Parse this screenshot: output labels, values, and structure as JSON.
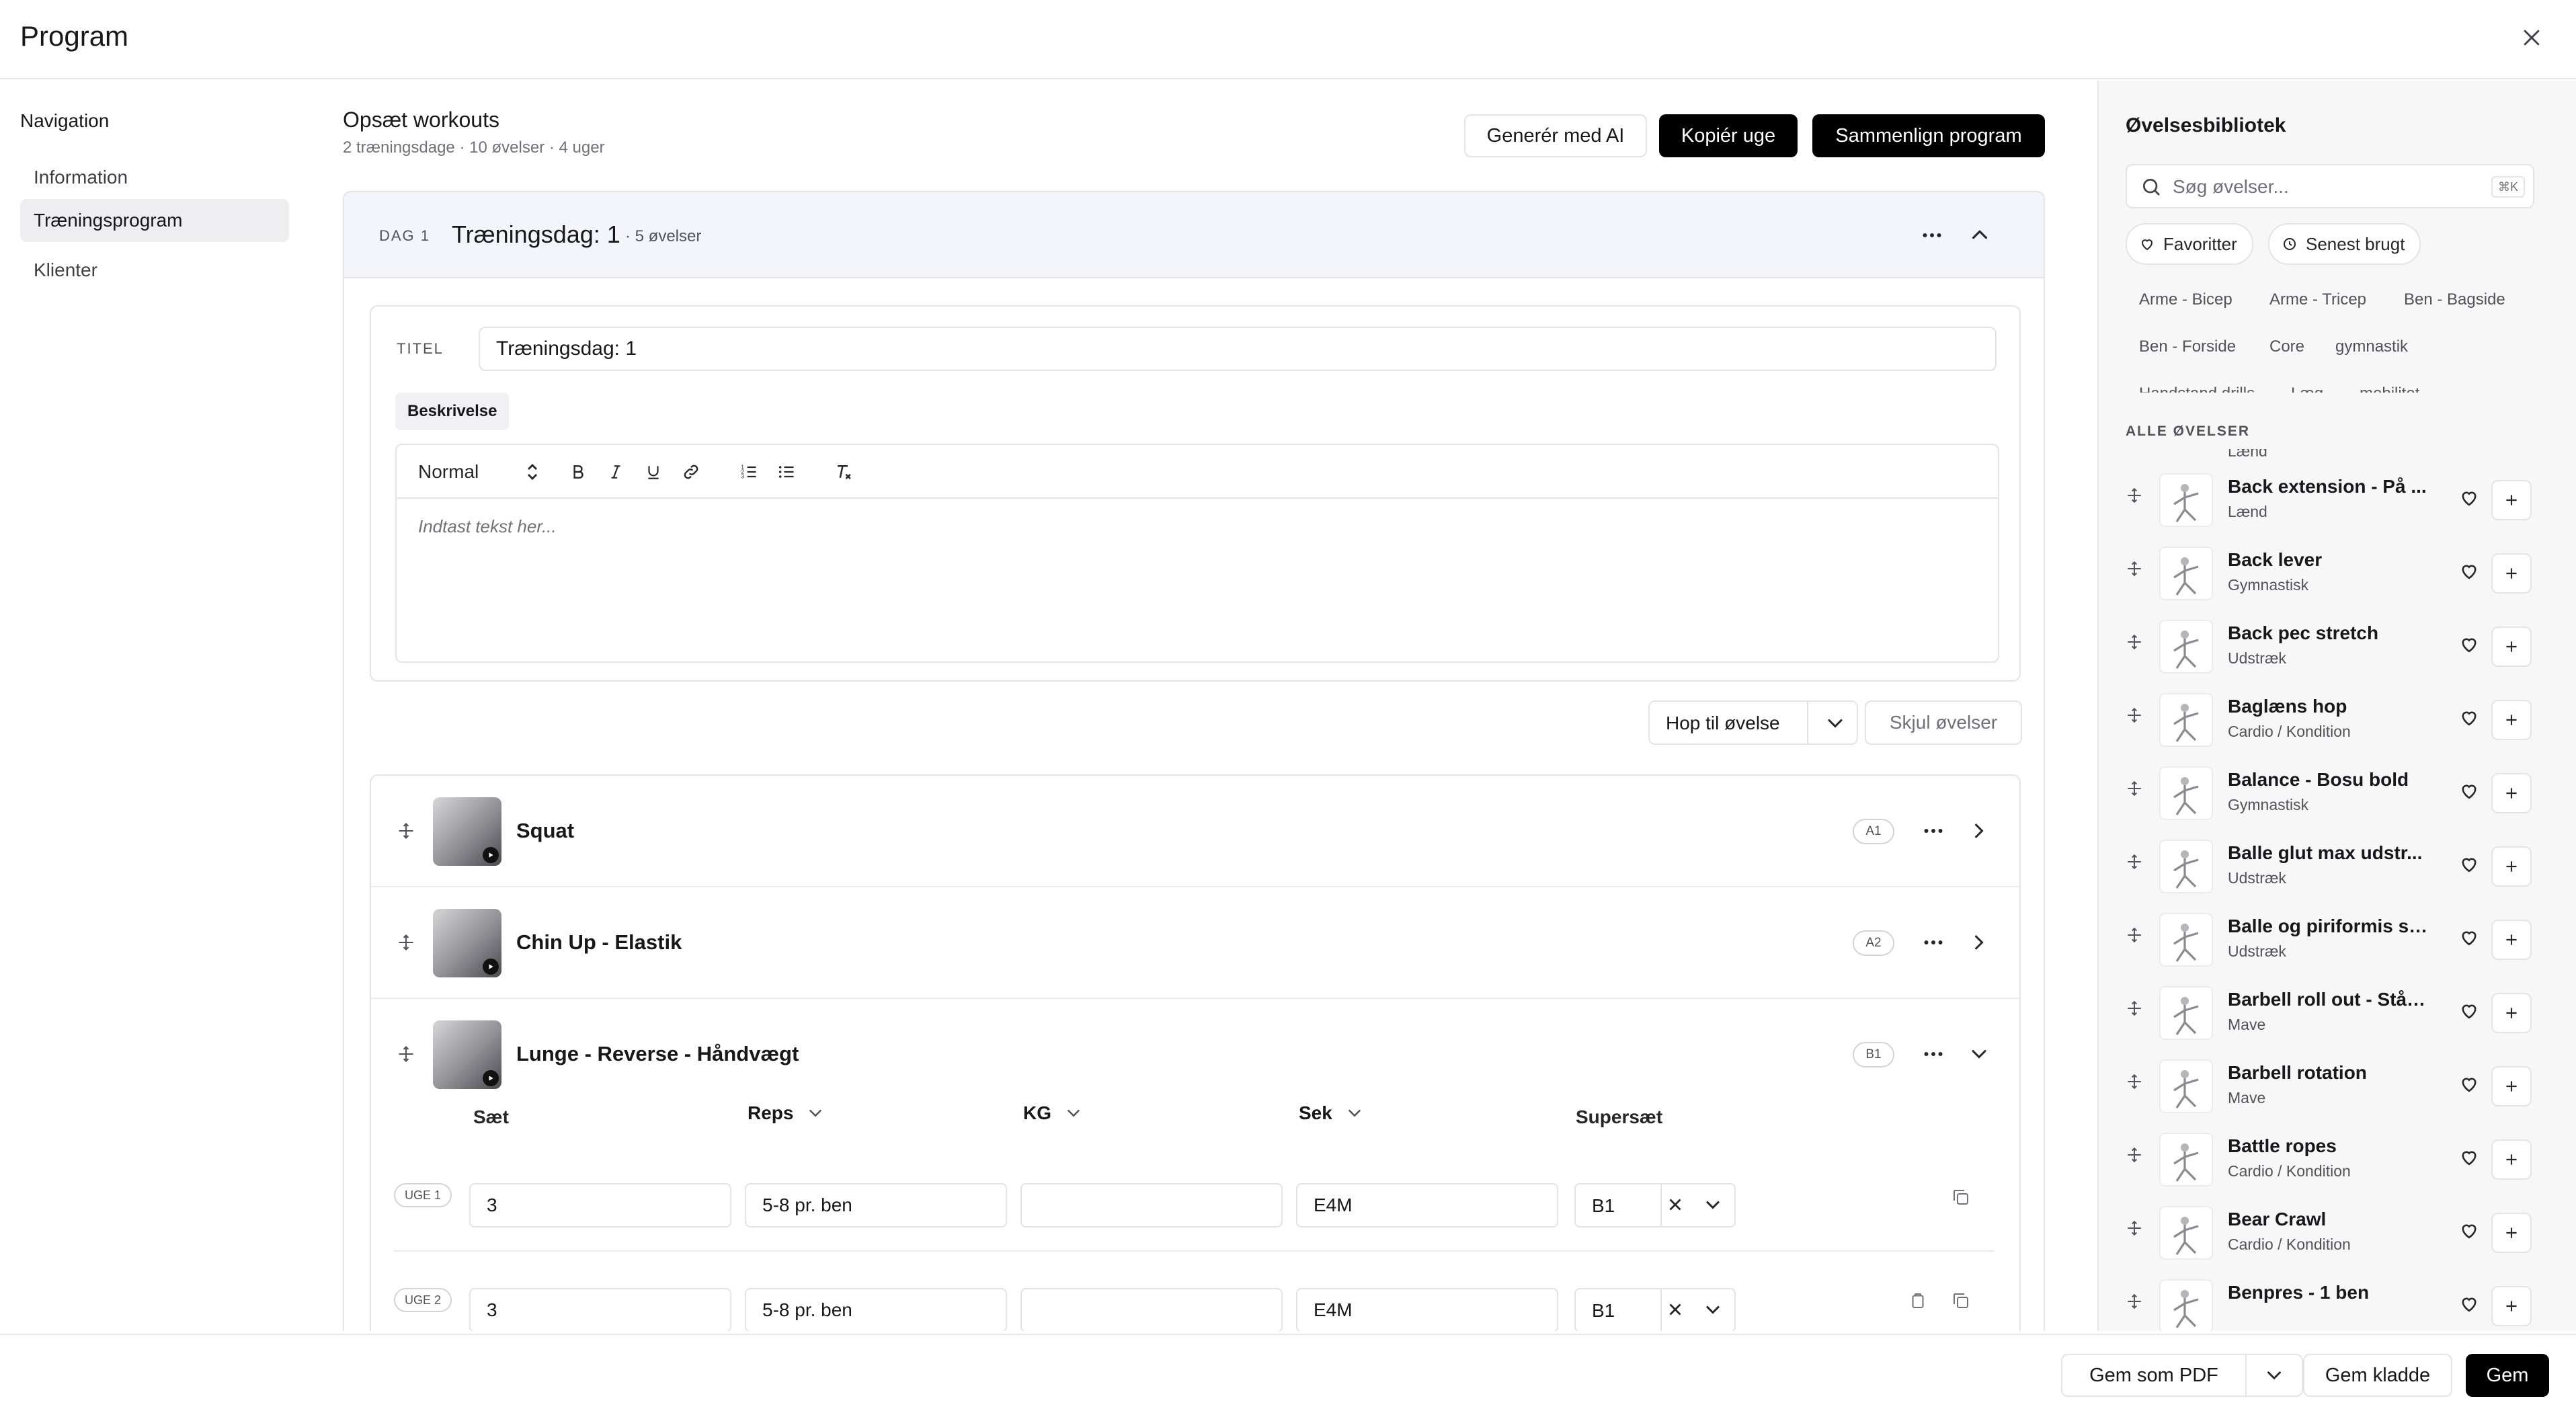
{
  "window": {
    "title": "Program"
  },
  "nav": {
    "heading": "Navigation",
    "items": [
      {
        "label": "Information"
      },
      {
        "label": "Træningsprogram"
      },
      {
        "label": "Klienter"
      }
    ]
  },
  "main": {
    "title": "Opsæt workouts",
    "subtitle": "2 træningsdage · 10 øvelser · 4 uger",
    "buttons": {
      "generate": "Generér med AI",
      "copy_week": "Kopiér uge",
      "compare": "Sammenlign program"
    }
  },
  "day": {
    "label": "DAG 1",
    "name": "Træningsdag: 1",
    "count": "· 5 øvelser",
    "titel_label": "TITEL",
    "titel_value": "Træningsdag: 1",
    "beskrivelse_label": "Beskrivelse",
    "editor": {
      "format": "Normal",
      "placeholder": "Indtast tekst her..."
    },
    "hop_label": "Hop til øvelse",
    "skjul_label": "Skjul øvelser"
  },
  "exercises": [
    {
      "name": "Squat",
      "badge": "A1"
    },
    {
      "name": "Chin Up - Elastik",
      "badge": "A2"
    },
    {
      "name": "Lunge - Reverse - Håndvægt",
      "badge": "B1"
    }
  ],
  "sets": {
    "headers": {
      "saet": "Sæt",
      "reps": "Reps",
      "kg": "KG",
      "sek": "Sek",
      "supersaet": "Supersæt"
    },
    "rows": [
      {
        "week": "UGE 1",
        "saet": "3",
        "reps": "5-8 pr. ben",
        "kg": "",
        "sek": "E4M",
        "super": "B1"
      },
      {
        "week": "UGE 2",
        "saet": "3",
        "reps": "5-8 pr. ben",
        "kg": "",
        "sek": "E4M",
        "super": "B1"
      }
    ]
  },
  "library": {
    "title": "Øvelsesbibliotek",
    "search_placeholder": "Søg øvelser...",
    "shortcut": "⌘K",
    "filters": {
      "favorites": "Favoritter",
      "recent": "Senest brugt"
    },
    "tags": [
      "Arme - Bicep",
      "Arme - Tricep",
      "Ben - Bagside",
      "Ben - Forside",
      "Core",
      "gymnastik",
      "Handstand drills",
      "Læg",
      "mobilitet"
    ],
    "section_label": "ALLE ØVELSER",
    "partial_category": "Lænd",
    "items": [
      {
        "name": "Back extension - På ...",
        "category": "Lænd"
      },
      {
        "name": "Back lever",
        "category": "Gymnastisk"
      },
      {
        "name": "Back pec stretch",
        "category": "Udstræk"
      },
      {
        "name": "Baglæns hop",
        "category": "Cardio / Kondition"
      },
      {
        "name": "Balance - Bosu bold",
        "category": "Gymnastisk"
      },
      {
        "name": "Balle glut max udstr...",
        "category": "Udstræk"
      },
      {
        "name": "Balle og piriformis str...",
        "category": "Udstræk"
      },
      {
        "name": "Barbell roll out - Ståe...",
        "category": "Mave"
      },
      {
        "name": "Barbell rotation",
        "category": "Mave"
      },
      {
        "name": "Battle ropes",
        "category": "Cardio / Kondition"
      },
      {
        "name": "Bear Crawl",
        "category": "Cardio / Kondition"
      },
      {
        "name": "Benpres - 1 ben",
        "category": ""
      }
    ]
  },
  "footer": {
    "pdf": "Gem som PDF",
    "draft": "Gem kladde",
    "save": "Gem"
  },
  "colors": {
    "primary": "#000000",
    "border": "#e4e4e7",
    "muted": "#71717a",
    "day_header_bg": "#f4f5fa",
    "panel_bg": "#f7f7f8"
  }
}
